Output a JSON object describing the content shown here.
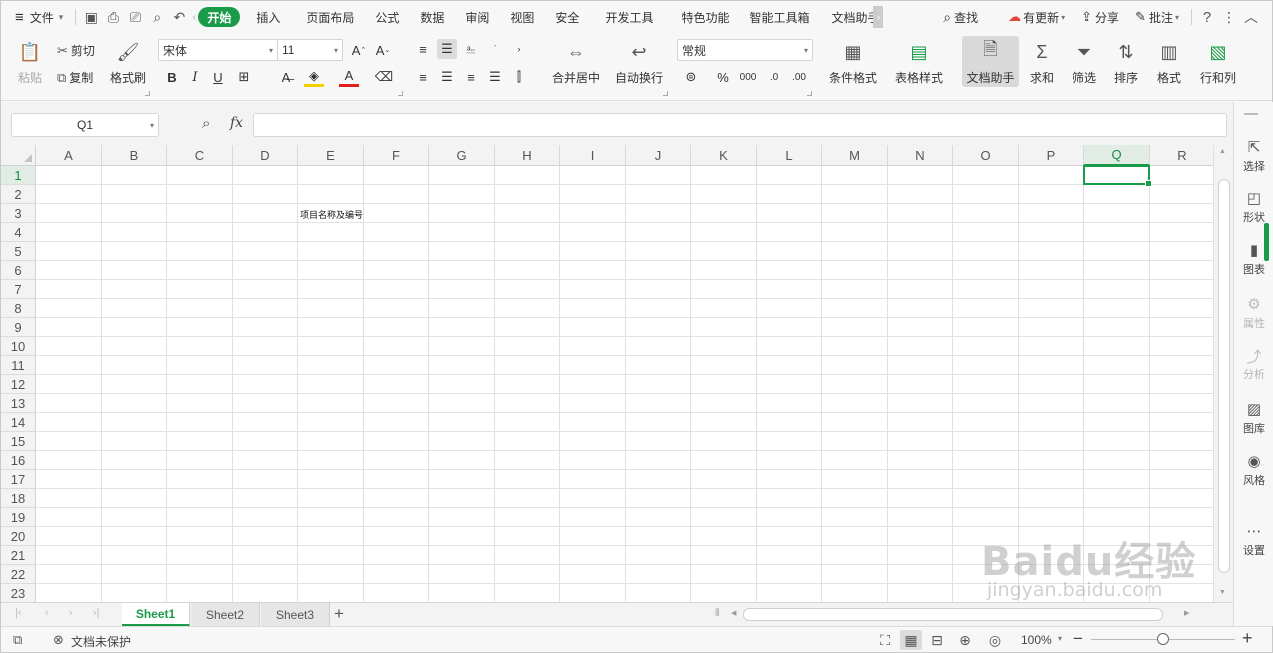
{
  "menubar": {
    "menu_toggle": "≡",
    "file_label": "文件",
    "tabs": [
      "开始",
      "插入",
      "页面布局",
      "公式",
      "数据",
      "审阅",
      "视图",
      "安全",
      "开发工具",
      "特色功能",
      "智能工具箱",
      "文档助手"
    ],
    "active_tab": "开始",
    "search_label": "查找",
    "cloud_label": "有更新",
    "share_label": "分享",
    "comment_label": "批注"
  },
  "ribbon": {
    "paste": "粘贴",
    "cut": "剪切",
    "copy": "复制",
    "format_painter": "格式刷",
    "font_name": "宋体",
    "font_size": "11",
    "merge_center": "合并居中",
    "auto_wrap": "自动换行",
    "number_format": "常规",
    "conditional_format": "条件格式",
    "table_style": "表格样式",
    "doc_assistant": "文档助手",
    "sum": "求和",
    "filter": "筛选",
    "sort": "排序",
    "format": "格式",
    "rows_cols": "行和列"
  },
  "formula_bar": {
    "name_box": "Q1",
    "fx": "fx",
    "formula": ""
  },
  "grid": {
    "columns": [
      "A",
      "B",
      "C",
      "D",
      "E",
      "F",
      "G",
      "H",
      "I",
      "J",
      "K",
      "L",
      "M",
      "N",
      "O",
      "P",
      "Q",
      "R"
    ],
    "rows": [
      "1",
      "2",
      "3",
      "4",
      "5",
      "6",
      "7",
      "8",
      "9",
      "10",
      "11",
      "12",
      "13",
      "14",
      "15",
      "16",
      "17",
      "18",
      "19",
      "20",
      "21",
      "22",
      "23"
    ],
    "selected_column": "Q",
    "selected_row": "1",
    "cell_E3": "项目名称及编号"
  },
  "side_panel": {
    "items": [
      {
        "label": "选择",
        "icon": "cursor-icon",
        "enabled": true
      },
      {
        "label": "形状",
        "icon": "shape-icon",
        "enabled": true
      },
      {
        "label": "图表",
        "icon": "chart-icon",
        "enabled": true
      },
      {
        "label": "属性",
        "icon": "property-icon",
        "enabled": false
      },
      {
        "label": "分析",
        "icon": "analysis-icon",
        "enabled": false
      },
      {
        "label": "图库",
        "icon": "gallery-icon",
        "enabled": true
      },
      {
        "label": "风格",
        "icon": "style-icon",
        "enabled": true
      },
      {
        "label": "设置",
        "icon": "more-icon",
        "enabled": true
      }
    ]
  },
  "sheets": {
    "tabs": [
      "Sheet1",
      "Sheet2",
      "Sheet3"
    ],
    "active": "Sheet1",
    "add": "+"
  },
  "statusbar": {
    "protect_label": "文档未保护",
    "zoom": "100%",
    "zoom_minus": "−",
    "zoom_plus": "+"
  },
  "watermark": {
    "brand": "Baidu经验",
    "url": "jingyan.baidu.com"
  },
  "colors": {
    "accent": "#1a9b4a",
    "selection_header": "#e1ece4"
  }
}
